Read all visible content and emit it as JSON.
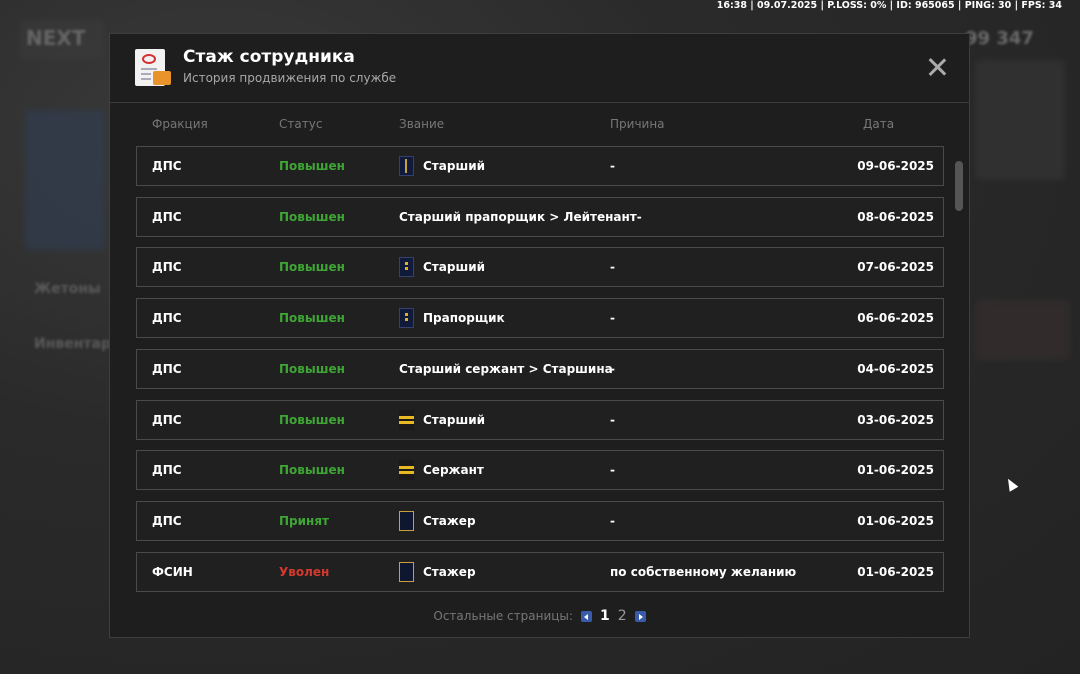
{
  "topbar": {
    "text": "16:38 | 09.07.2025 | P.LOSS: 0% | ID: 965065 | PING: 30 | FPS: 34"
  },
  "background": {
    "side_left_1": "Жетоны",
    "side_left_2": "Инвентарь",
    "logo": "NEXT",
    "money": "99 347"
  },
  "modal": {
    "title": "Стаж сотрудника",
    "subtitle": "История продвижения по службе",
    "close_icon": "close-icon"
  },
  "columns": {
    "faction": "Фракция",
    "status": "Статус",
    "rank": "Звание",
    "reason": "Причина",
    "date": "Дата"
  },
  "rows": [
    {
      "faction": "ДПС",
      "status": "Повышен",
      "status_type": "good",
      "badge": "gold-stripe",
      "rank": "Старший",
      "reason": "-",
      "date": "09-06-2025"
    },
    {
      "faction": "ДПС",
      "status": "Повышен",
      "status_type": "good",
      "badge": "",
      "rank": "Старший прапорщик > Лейтенант-",
      "reason": "",
      "date": "08-06-2025"
    },
    {
      "faction": "ДПС",
      "status": "Повышен",
      "status_type": "good",
      "badge": "gold",
      "rank": "Старший",
      "reason": "-",
      "date": "07-06-2025"
    },
    {
      "faction": "ДПС",
      "status": "Повышен",
      "status_type": "good",
      "badge": "gold",
      "rank": "Прапорщик",
      "reason": "-",
      "date": "06-06-2025"
    },
    {
      "faction": "ДПС",
      "status": "Повышен",
      "status_type": "good",
      "badge": "",
      "rank": "Старший сержант > Старшина",
      "reason": "-",
      "date": "04-06-2025"
    },
    {
      "faction": "ДПС",
      "status": "Повышен",
      "status_type": "good",
      "badge": "bars",
      "rank": "Старший",
      "reason": "-",
      "date": "03-06-2025"
    },
    {
      "faction": "ДПС",
      "status": "Повышен",
      "status_type": "good",
      "badge": "bars",
      "rank": "Сержант",
      "reason": "-",
      "date": "01-06-2025"
    },
    {
      "faction": "ДПС",
      "status": "Принят",
      "status_type": "good",
      "badge": "plain",
      "rank": "Стажер",
      "reason": "-",
      "date": "01-06-2025"
    },
    {
      "faction": "ФСИН",
      "status": "Уволен",
      "status_type": "bad",
      "badge": "plain",
      "rank": "Стажер",
      "reason": "по собственному желанию",
      "date": "01-06-2025"
    }
  ],
  "pager": {
    "label": "Остальные страницы:",
    "pages": [
      "1",
      "2"
    ],
    "current": "1"
  },
  "colors": {
    "good": "#3fa535",
    "bad": "#d23a2e",
    "pager_arrow": "#3a5ca8"
  }
}
